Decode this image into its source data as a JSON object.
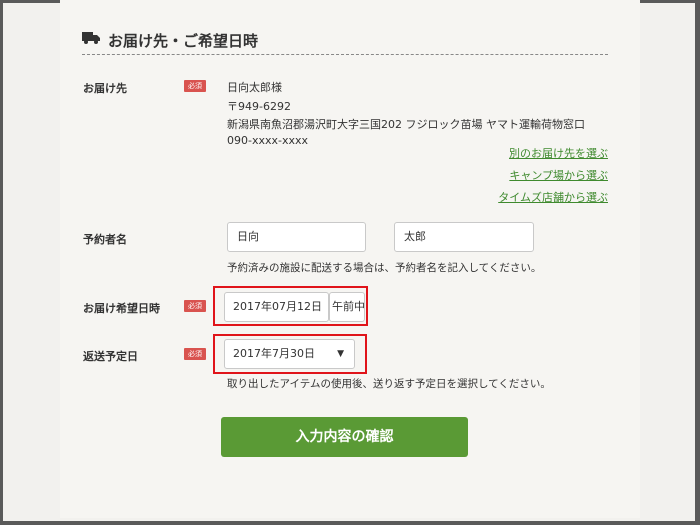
{
  "section": {
    "title": "お届け先・ご希望日時",
    "icon": "truck-icon"
  },
  "required_badge": "必須",
  "delivery": {
    "label": "お届け先",
    "name": "日向太郎様",
    "postal": "〒949-6292",
    "address": "新潟県南魚沼郡湯沢町大字三国202 フジロック苗場 ヤマト運輸荷物窓口",
    "phone": "090-xxxx-xxxx",
    "links": [
      "別のお届け先を選ぶ",
      "キャンプ場から選ぶ",
      "タイムズ店舗から選ぶ"
    ]
  },
  "reserver": {
    "label": "予約者名",
    "last_name": "日向",
    "first_name": "太郎",
    "note": "予約済みの施設に配送する場合は、予約者名を記入してください。"
  },
  "delivery_date": {
    "label": "お届け希望日時",
    "value": "2017年07月12日",
    "time_value": "午前中"
  },
  "return_date": {
    "label": "返送予定日",
    "value": "2017年7月30日",
    "note": "取り出したアイテムの使用後、送り返す予定日を選択してください。"
  },
  "confirm_button": "入力内容の確認",
  "colors": {
    "accent": "#5a9a35",
    "badge": "#d9534f",
    "highlight": "#e0141a",
    "link": "#3f8a2e"
  }
}
